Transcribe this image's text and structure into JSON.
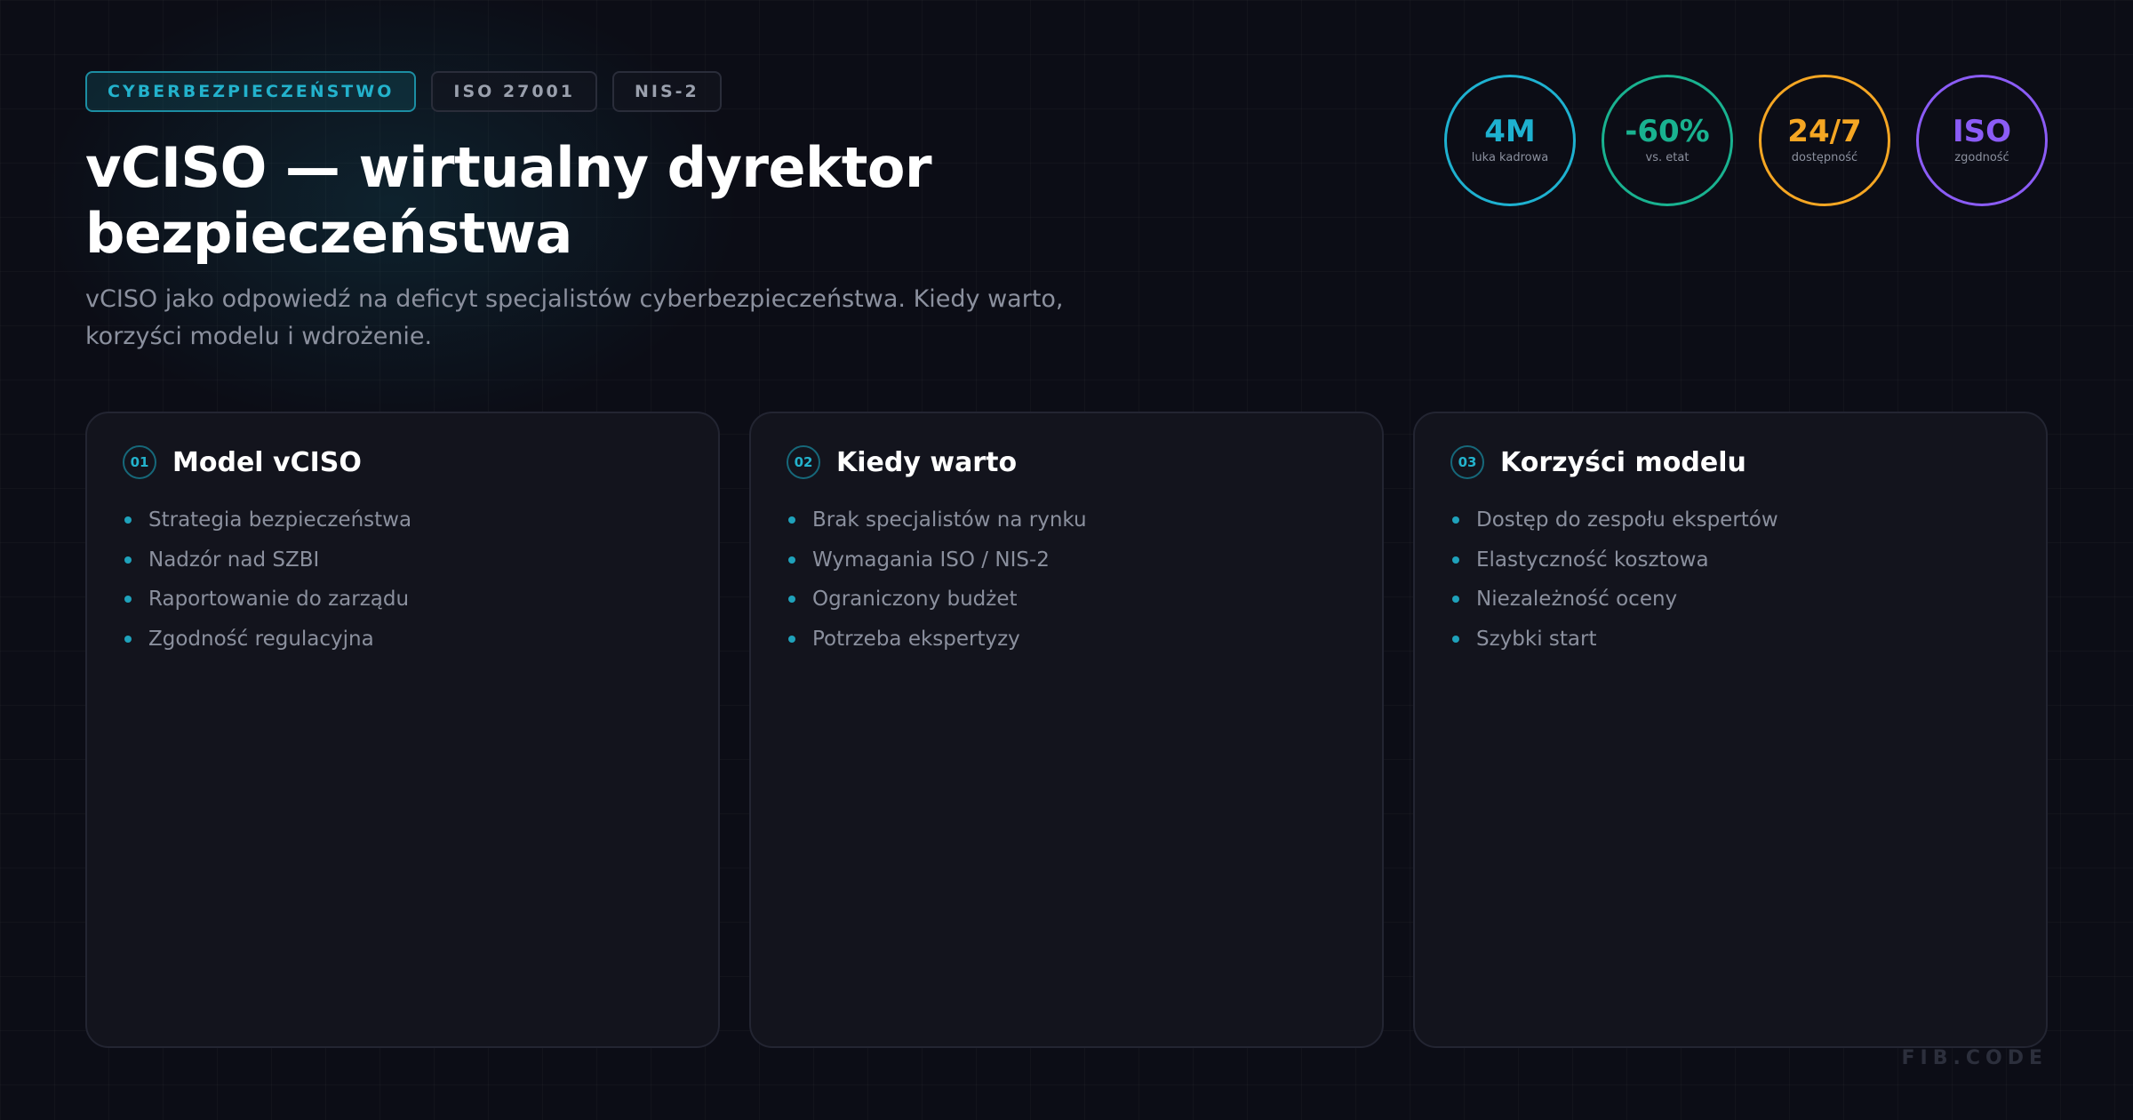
{
  "tags": [
    {
      "label": "CYBERBEZPIECZEŃSTWO"
    },
    {
      "label": "ISO 27001"
    },
    {
      "label": "NIS-2"
    }
  ],
  "title": "vCISO — wirtualny dyrektor bezpieczeństwa",
  "subtitle": "vCISO jako odpowiedź na deficyt specjalistów cyberbezpieczeństwa. Kiedy warto, korzyści modelu i wdrożenie.",
  "stats": [
    {
      "value": "4M",
      "label": "luka kadrowa",
      "color": "#1eb1d0"
    },
    {
      "value": "-60%",
      "label": "vs. etat",
      "color": "#19b290"
    },
    {
      "value": "24/7",
      "label": "dostępność",
      "color": "#f5a623"
    },
    {
      "value": "ISO",
      "label": "zgodność",
      "color": "#8b5cf6"
    }
  ],
  "cards": [
    {
      "number": "01",
      "title": "Model vCISO",
      "items": [
        "Strategia bezpieczeństwa",
        "Nadzór nad SZBI",
        "Raportowanie do zarządu",
        "Zgodność regulacyjna"
      ]
    },
    {
      "number": "02",
      "title": "Kiedy warto",
      "items": [
        "Brak specjalistów na rynku",
        "Wymagania ISO / NIS-2",
        "Ograniczony budżet",
        "Potrzeba ekspertyzy"
      ]
    },
    {
      "number": "03",
      "title": "Korzyści modelu",
      "items": [
        "Dostęp do zespołu ekspertów",
        "Elastyczność kosztowa",
        "Niezależność oceny",
        "Szybki start"
      ]
    }
  ],
  "brand": "FIB.CODE",
  "colors": {
    "accent": "#23b2cc",
    "background": "#0c0d16",
    "card": "#13141d"
  }
}
